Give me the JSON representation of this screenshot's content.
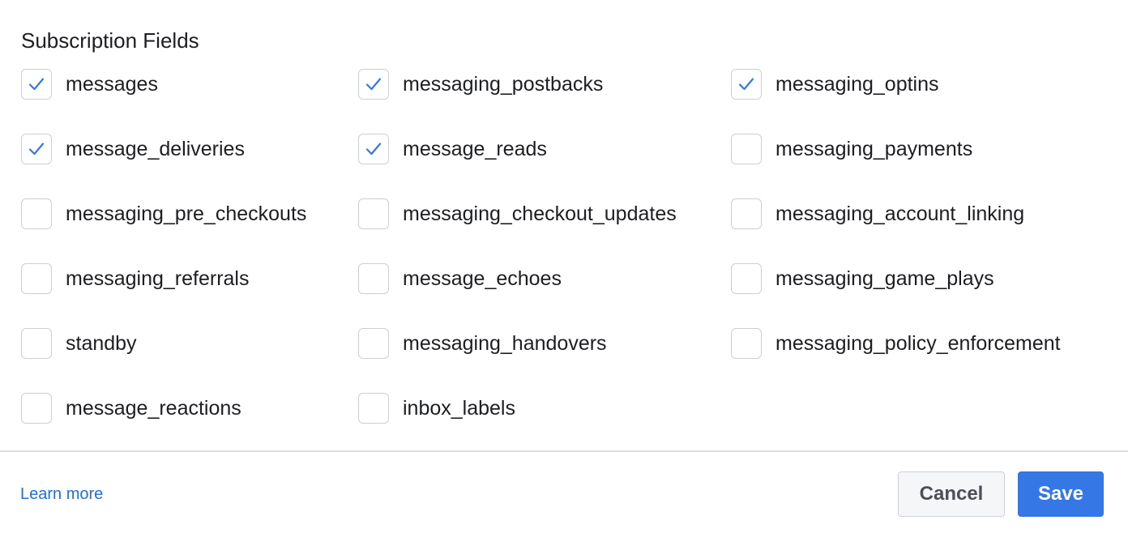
{
  "section": {
    "title": "Subscription Fields"
  },
  "fields": [
    [
      {
        "label": "messages",
        "checked": true
      },
      {
        "label": "messaging_postbacks",
        "checked": true
      },
      {
        "label": "messaging_optins",
        "checked": true
      }
    ],
    [
      {
        "label": "message_deliveries",
        "checked": true
      },
      {
        "label": "message_reads",
        "checked": true
      },
      {
        "label": "messaging_payments",
        "checked": false
      }
    ],
    [
      {
        "label": "messaging_pre_checkouts",
        "checked": false
      },
      {
        "label": "messaging_checkout_updates",
        "checked": false
      },
      {
        "label": "messaging_account_linking",
        "checked": false
      }
    ],
    [
      {
        "label": "messaging_referrals",
        "checked": false
      },
      {
        "label": "message_echoes",
        "checked": false
      },
      {
        "label": "messaging_game_plays",
        "checked": false
      }
    ],
    [
      {
        "label": "standby",
        "checked": false
      },
      {
        "label": "messaging_handovers",
        "checked": false
      },
      {
        "label": "messaging_policy_enforcement",
        "checked": false
      }
    ],
    [
      {
        "label": "message_reactions",
        "checked": false
      },
      {
        "label": "inbox_labels",
        "checked": false
      }
    ]
  ],
  "footer": {
    "learn_more": "Learn more",
    "cancel_label": "Cancel",
    "save_label": "Save"
  },
  "colors": {
    "accent": "#3578e5",
    "link": "#216fdb",
    "checkmark": "#3578e5",
    "checkbox_border": "#ccd0d5",
    "divider": "#dadde1"
  },
  "icons": {
    "checkmark": "check-icon"
  }
}
